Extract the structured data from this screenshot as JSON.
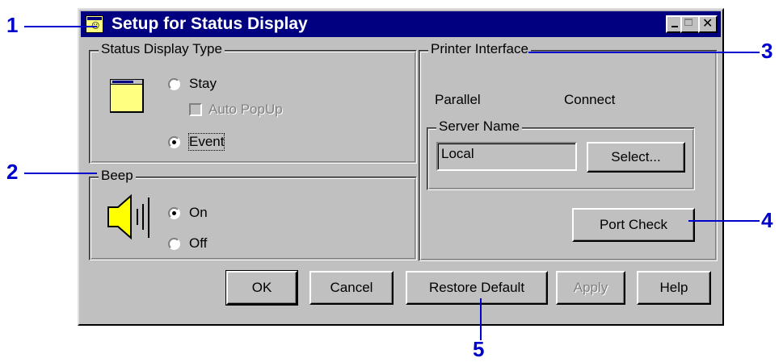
{
  "window": {
    "title": "Setup for Status Display"
  },
  "status_display_type": {
    "legend": "Status Display Type",
    "option_stay": "Stay",
    "option_auto_popup": "Auto PopUp",
    "option_event": "Event",
    "selected": "Event",
    "auto_popup_checked": false
  },
  "beep": {
    "legend": "Beep",
    "option_on": "On",
    "option_off": "Off",
    "selected": "On"
  },
  "printer_interface": {
    "legend": "Printer Interface",
    "port": "Parallel",
    "status": "Connect",
    "server_name": {
      "legend": "Server Name",
      "value": "Local",
      "select_button": "Select..."
    },
    "port_check_button": "Port Check"
  },
  "buttons": {
    "ok": "OK",
    "cancel": "Cancel",
    "restore_default": "Restore Default",
    "apply": "Apply",
    "help": "Help"
  },
  "callouts": {
    "c1": "1",
    "c2": "2",
    "c3": "3",
    "c4": "4",
    "c5": "5"
  },
  "colors": {
    "titlebar": "#000080",
    "dialog_face": "#c0c0c0",
    "callout": "#0000cc"
  }
}
